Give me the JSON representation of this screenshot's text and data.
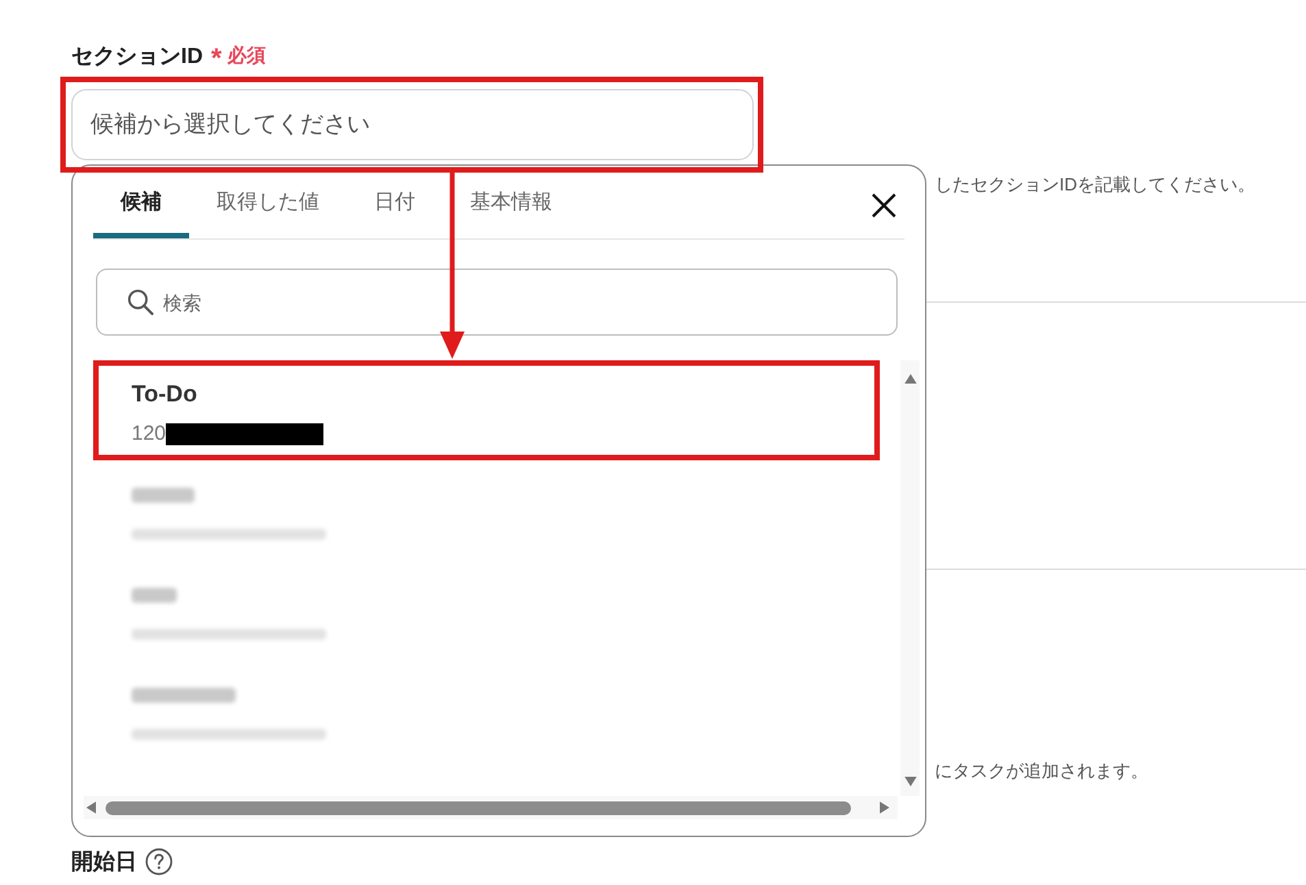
{
  "form": {
    "section_id": {
      "label": "セクションID",
      "required_mark": "*",
      "required_text": "必須",
      "placeholder": "候補から選択してください",
      "highlighted": true,
      "help_text": "したセクションIDを記載してください。"
    },
    "other_help_text": "にタスクが追加されます。",
    "start_date": {
      "label": "開始日"
    }
  },
  "dropdown": {
    "tabs": [
      {
        "label": "候補",
        "selected": true
      },
      {
        "label": "取得した値",
        "selected": false
      },
      {
        "label": "日付",
        "selected": false
      },
      {
        "label": "基本情報",
        "selected": false
      }
    ],
    "search": {
      "placeholder": "検索"
    },
    "options": [
      {
        "kind": "entry",
        "name": "To-Do",
        "id": "120",
        "redacted": true,
        "highlighted": true
      },
      {
        "kind": "blurred",
        "highlighted": false
      },
      {
        "kind": "blurred",
        "highlighted": false
      },
      {
        "kind": "blurred",
        "highlighted": false
      }
    ]
  },
  "annotation": {
    "arrow": true
  }
}
